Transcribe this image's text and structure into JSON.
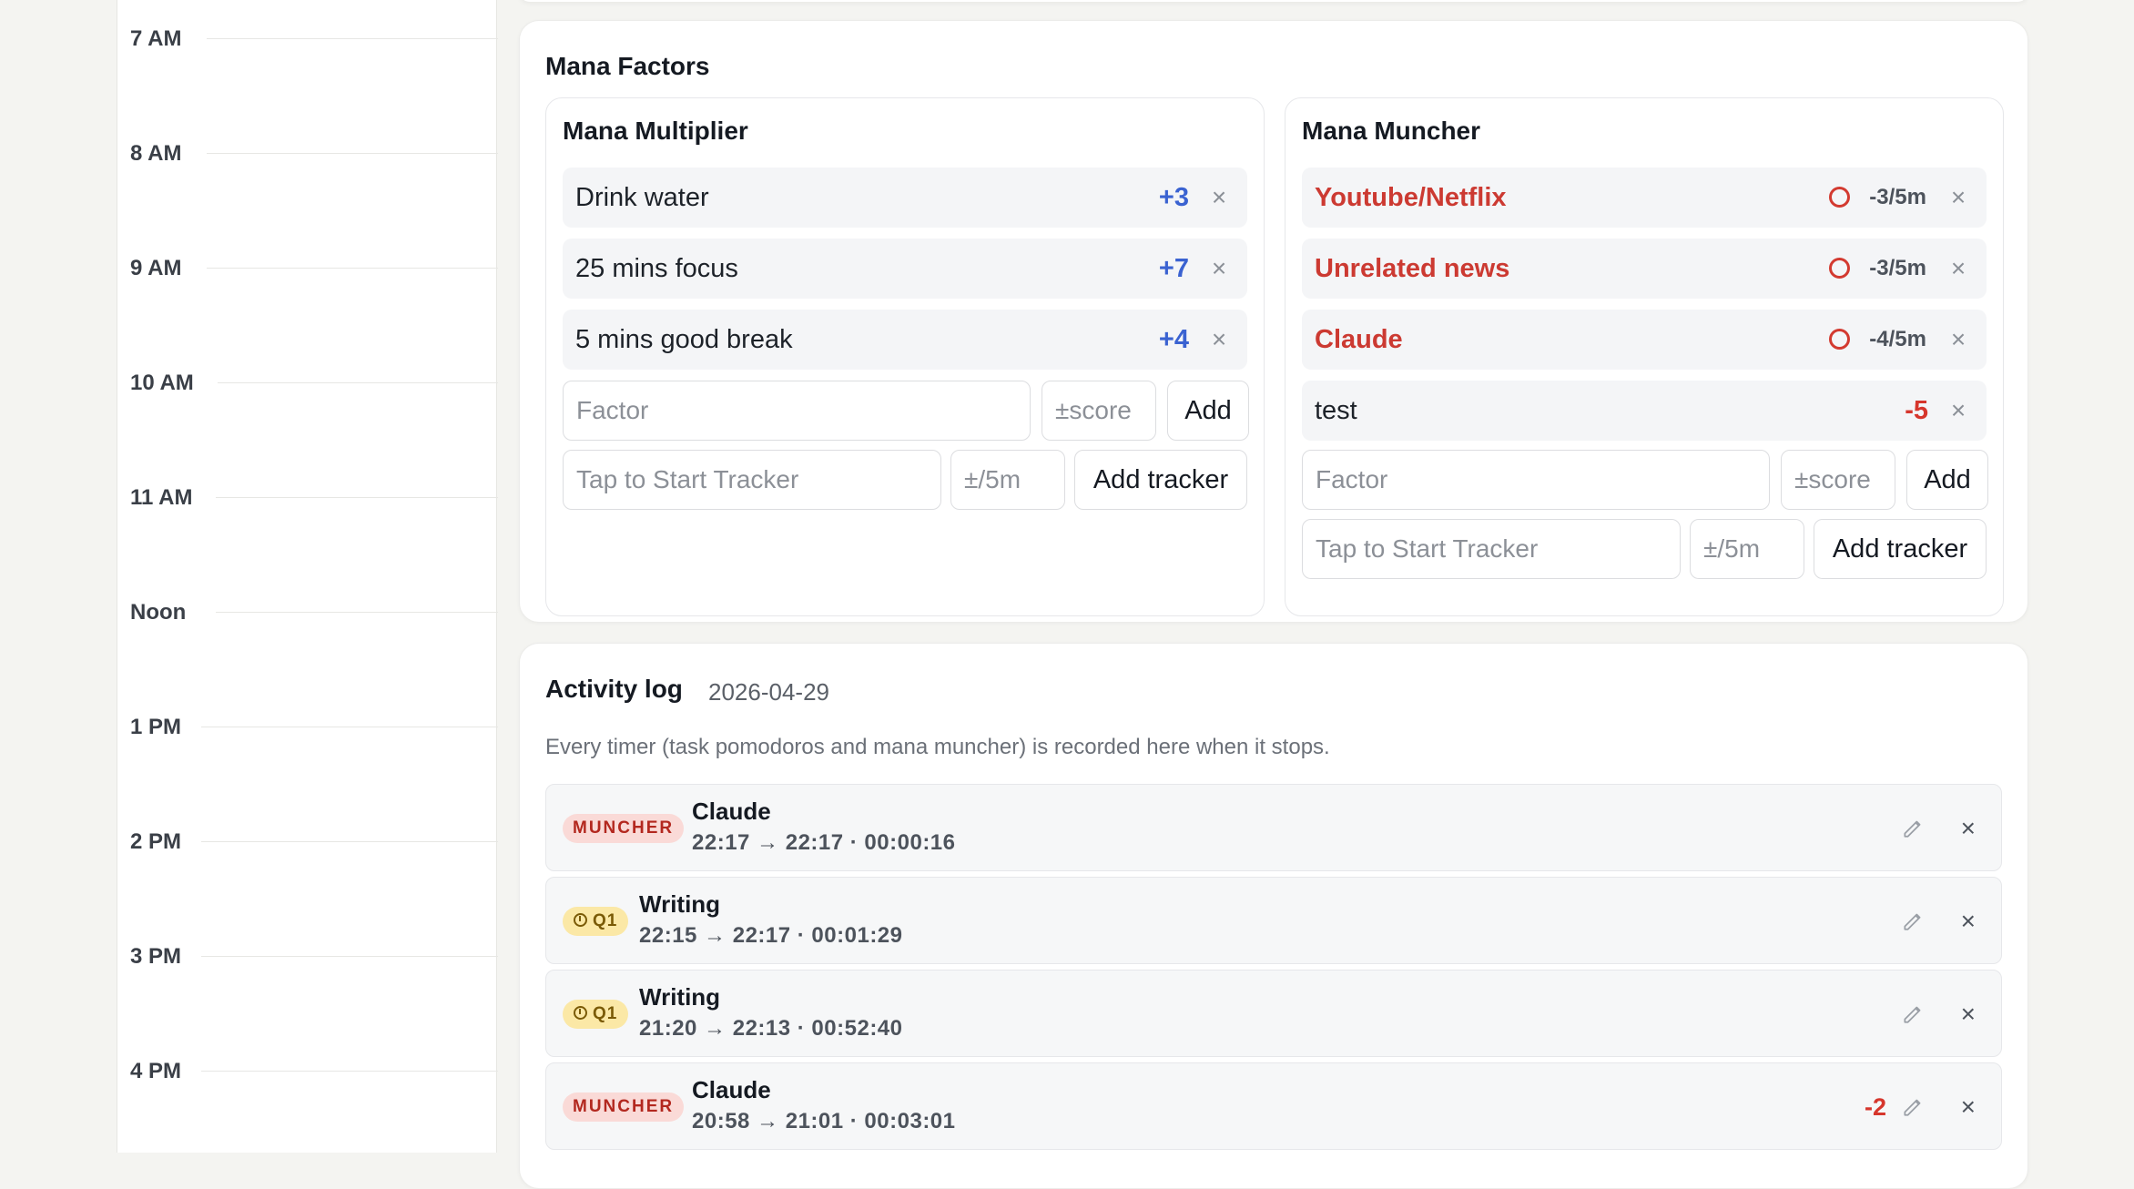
{
  "timeline": {
    "hours": [
      "7 AM",
      "8 AM",
      "9 AM",
      "10 AM",
      "11 AM",
      "Noon",
      "1 PM",
      "2 PM",
      "3 PM",
      "4 PM"
    ]
  },
  "mana_factors": {
    "title": "Mana Factors",
    "multiplier": {
      "title": "Mana Multiplier",
      "items": [
        {
          "name": "Drink water",
          "value": "+3"
        },
        {
          "name": "25 mins focus",
          "value": "+7"
        },
        {
          "name": "5 mins good break",
          "value": "+4"
        }
      ],
      "factor_placeholder": "Factor",
      "score_placeholder": "±score",
      "add_label": "Add",
      "tracker_placeholder": "Tap to Start Tracker",
      "rate_placeholder": "±/5m",
      "add_tracker_label": "Add tracker"
    },
    "muncher": {
      "title": "Mana Muncher",
      "items": [
        {
          "name": "Youtube/Netflix",
          "value": "-3/5m",
          "tracker": true
        },
        {
          "name": "Unrelated news",
          "value": "-3/5m",
          "tracker": true
        },
        {
          "name": "Claude",
          "value": "-4/5m",
          "tracker": true
        },
        {
          "name": "test",
          "value": "-5",
          "tracker": false
        }
      ],
      "factor_placeholder": "Factor",
      "score_placeholder": "±score",
      "add_label": "Add",
      "tracker_placeholder": "Tap to Start Tracker",
      "rate_placeholder": "±/5m",
      "add_tracker_label": "Add tracker"
    },
    "remove_symbol": "×",
    "icon": "circle-tracker-icon"
  },
  "activity_log": {
    "title": "Activity log",
    "date": "2026-04-29",
    "subtitle": "Every timer (task pomodoros and mana muncher) is recorded here when it stops.",
    "entries": [
      {
        "badge": "MUNCHER",
        "badge_type": "muncher",
        "name": "Claude",
        "time": "22:17 → 22:17 · 00:00:16",
        "delta": ""
      },
      {
        "badge": "Q1",
        "badge_type": "q1",
        "name": "Writing",
        "time": "22:15 → 22:17 · 00:01:29",
        "delta": ""
      },
      {
        "badge": "Q1",
        "badge_type": "q1",
        "name": "Writing",
        "time": "21:20 → 22:13 · 00:52:40",
        "delta": ""
      },
      {
        "badge": "MUNCHER",
        "badge_type": "muncher",
        "name": "Claude",
        "time": "20:58 → 21:01 · 00:03:01",
        "delta": "-2"
      }
    ],
    "remove_symbol": "×",
    "edit_icon": "pencil-icon"
  },
  "colors": {
    "multiplier_value": "#3a62d1",
    "muncher_value": "#d6362c",
    "muncher_badge_bg": "#fadad7",
    "q1_badge_bg": "#fbe8a6"
  }
}
